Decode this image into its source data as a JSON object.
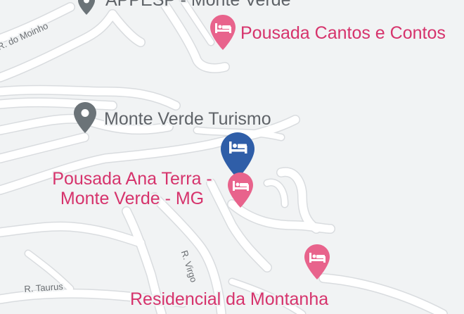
{
  "map": {
    "colors": {
      "background": "#f1f3f4",
      "road": "#ffffff",
      "road_casing": "#d9dcdf",
      "hotel_pin": "#e8638c",
      "hotel_label": "#d6336c",
      "selected_pin": "#2f5ea8",
      "place_pin": "#6b7378",
      "place_label": "#5f6368"
    },
    "labels": {
      "top_partial": "APPESP - Monte Verde",
      "pousada_cantos": "Pousada Cantos e Contos",
      "monte_verde_turismo": "Monte Verde Turismo",
      "ana_terra_line1": "Pousada Ana Terra -",
      "ana_terra_line2": "Monte Verde - MG",
      "residencial": "Residencial da Montanha"
    },
    "streets": {
      "moinho": "R. do Moinho",
      "virgo": "R. Virgo",
      "taurus": "R. Taurus"
    },
    "icons": {
      "hotel": "bed-icon",
      "place": "location-pin-icon"
    }
  }
}
